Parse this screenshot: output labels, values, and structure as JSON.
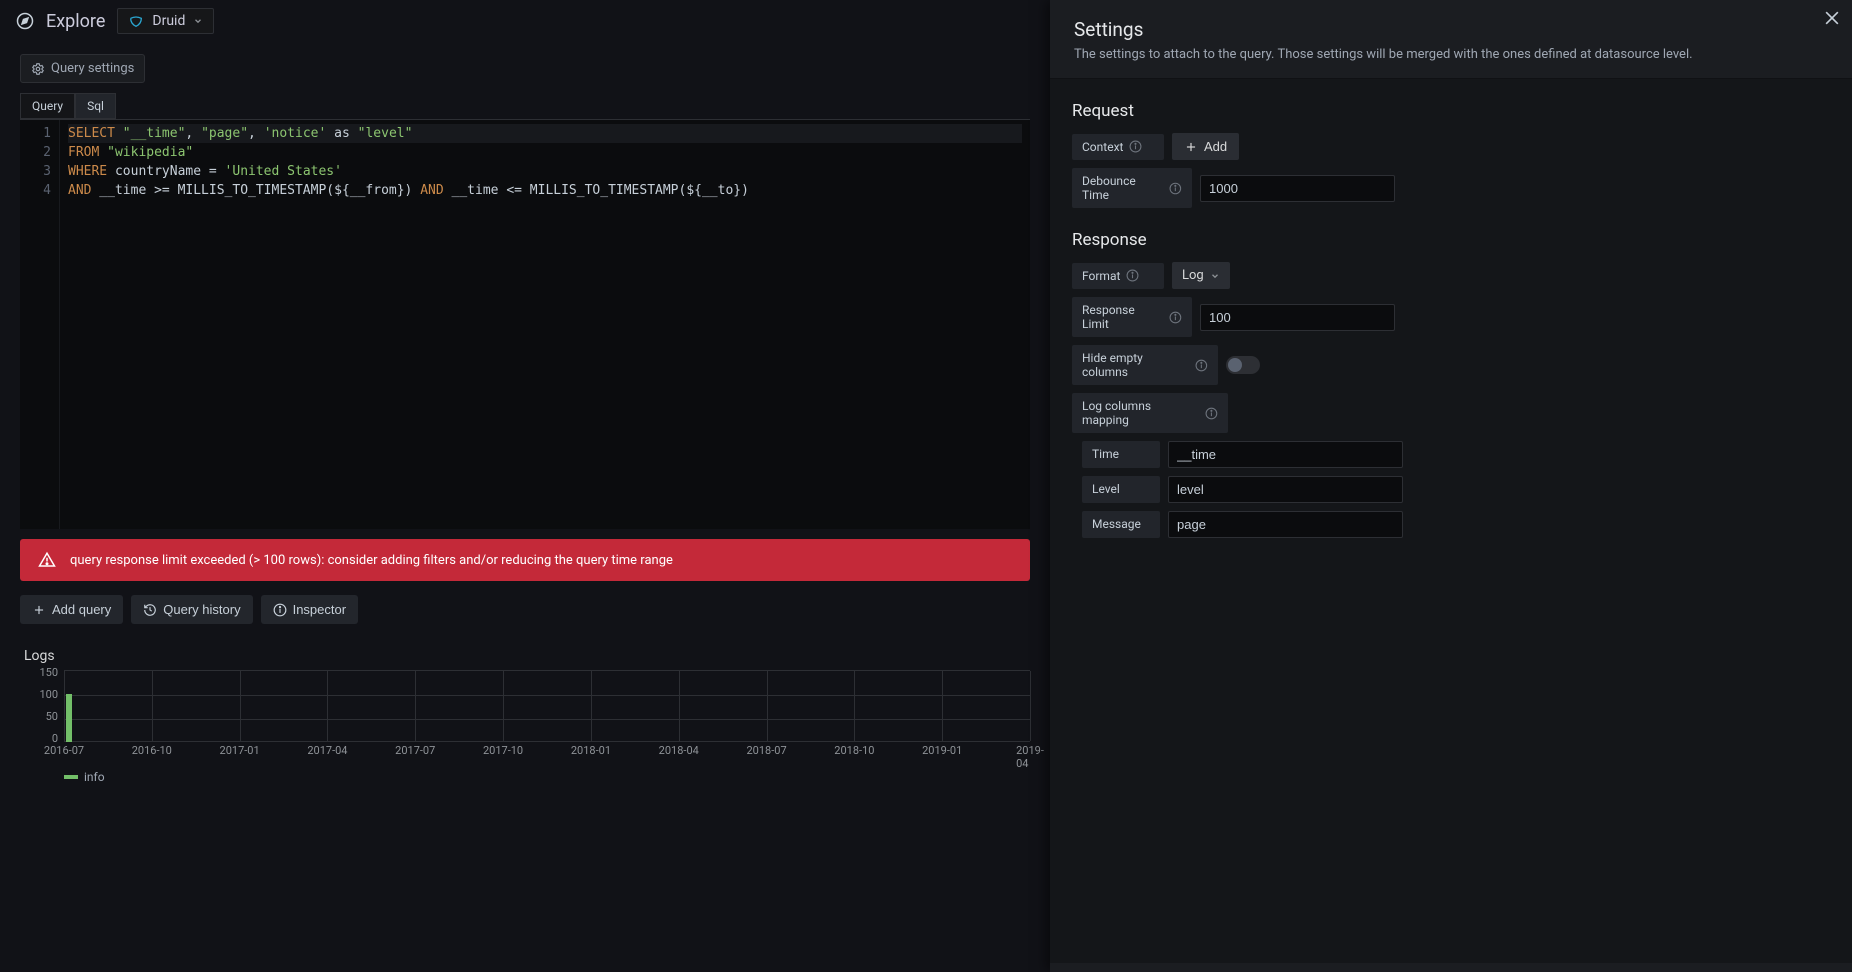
{
  "header": {
    "title": "Explore",
    "datasource": "Druid"
  },
  "query_settings_btn": "Query settings",
  "tabs": {
    "query": "Query",
    "sql": "Sql"
  },
  "editor": {
    "line1_select": "SELECT",
    "line1_cols_a": "\"__time\"",
    "line1_sep1": ", ",
    "line1_cols_b": "\"page\"",
    "line1_sep2": ", ",
    "line1_cols_c": "'notice'",
    "line1_as": " as ",
    "line1_cols_d": "\"level\"",
    "line2_from": "FROM",
    "line2_tbl": " \"wikipedia\"",
    "line3_where": "WHERE",
    "line3_rest": " countryName = ",
    "line3_val": "'United States'",
    "line4_and1": "AND",
    "line4_a": " __time >= MILLIS_TO_TIMESTAMP(${__from}) ",
    "line4_and2": "AND",
    "line4_b": " __time <= MILLIS_TO_TIMESTAMP(${__to})"
  },
  "warning": "query response limit exceeded (> 100 rows): consider adding filters and/or reducing the query time range",
  "toolbar": {
    "add_query": "Add query",
    "query_history": "Query history",
    "inspector": "Inspector"
  },
  "logs": {
    "title": "Logs",
    "legend_info": "info"
  },
  "chart_data": {
    "type": "bar",
    "series": [
      {
        "name": "info",
        "color": "#73bf69",
        "values": [
          100
        ]
      }
    ],
    "categories_idx": [
      0
    ],
    "ylim": [
      0,
      150
    ],
    "yticks": [
      0,
      50,
      100,
      150
    ],
    "xticks": [
      "2016-07",
      "2016-10",
      "2017-01",
      "2017-04",
      "2017-07",
      "2017-10",
      "2018-01",
      "2018-04",
      "2018-07",
      "2018-10",
      "2019-01",
      "2019-04"
    ]
  },
  "panel": {
    "title": "Settings",
    "subtitle": "The settings to attach to the query. Those settings will be merged with the ones defined at datasource level.",
    "request_h": "Request",
    "context_label": "Context",
    "add_btn": "Add",
    "debounce_label": "Debounce Time",
    "debounce_value": "1000",
    "response_h": "Response",
    "format_label": "Format",
    "format_value": "Log",
    "resp_limit_label": "Response Limit",
    "resp_limit_value": "100",
    "hide_empty_label": "Hide empty columns",
    "log_map_label": "Log columns mapping",
    "map_time_label": "Time",
    "map_time_value": "__time",
    "map_level_label": "Level",
    "map_level_value": "level",
    "map_msg_label": "Message",
    "map_msg_value": "page"
  }
}
